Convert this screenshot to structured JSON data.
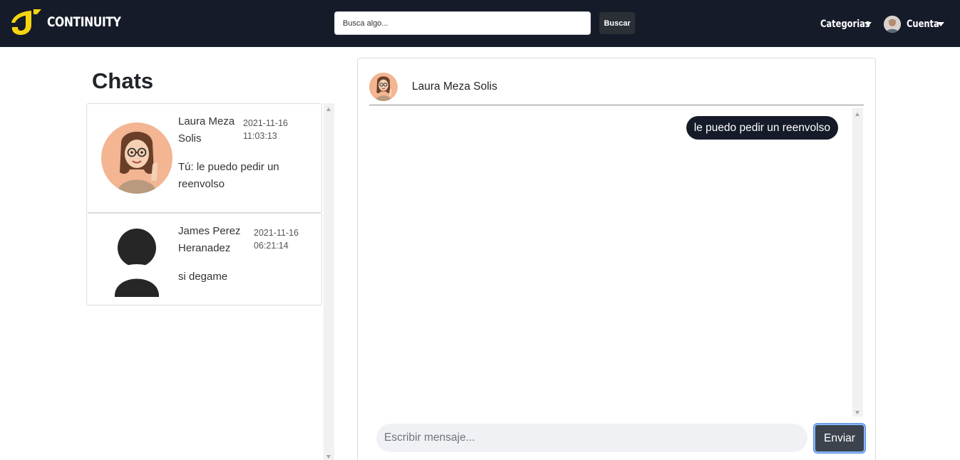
{
  "navbar": {
    "brand": "CONTINUITY",
    "search": {
      "placeholder": "Busca algo...",
      "value": ""
    },
    "search_button": "Buscar",
    "categories": "Categorias",
    "account": "Cuenta"
  },
  "sidebar": {
    "title": "Chats",
    "chats": [
      {
        "name": "Laura Meza Solis",
        "date": "2021-11-16",
        "time": "11:03:13",
        "preview": "Tú: le puedo pedir un reenvolso",
        "avatar": "bitmoji-woman-avatar"
      },
      {
        "name": "James Perez Heranadez",
        "date": "2021-11-16",
        "time": "06:21:14",
        "preview": "si degame",
        "avatar": "default-person-avatar"
      }
    ]
  },
  "conversation": {
    "contact_name": "Laura Meza Solis",
    "messages": [
      {
        "text": "le puedo pedir un reenvolso",
        "from": "me"
      }
    ],
    "input": {
      "placeholder": "Escribir mensaje...",
      "value": ""
    },
    "send_button": "Enviar"
  },
  "colors": {
    "navbar_bg": "#151b29",
    "logo_yellow": "#f5d410",
    "bubble_bg": "#151b29",
    "send_button_bg": "#3c434c",
    "focus_ring": "#86b7fe"
  }
}
